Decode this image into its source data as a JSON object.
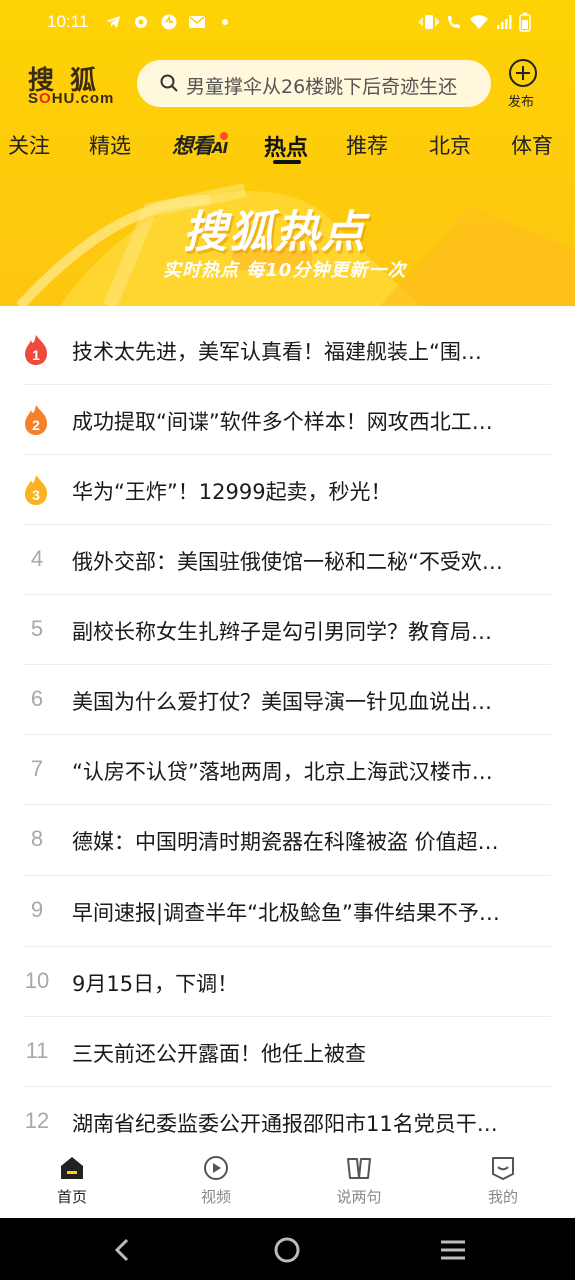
{
  "status_bar": {
    "time": "10:11",
    "left_icons": [
      "telegram-icon",
      "settings-icon",
      "app-icon",
      "mail-icon",
      "dot-icon"
    ],
    "right_icons": [
      "vibrate-icon",
      "wifi-call-icon",
      "wifi-icon",
      "signal-icon",
      "battery-icon"
    ]
  },
  "header": {
    "logo_cn": "搜狐",
    "logo_en_prefix": "S",
    "logo_en_o": "O",
    "logo_en_suffix": "HU.com",
    "search_placeholder": "男童撑伞从26楼跳下后奇迹生还",
    "publish_label": "发布"
  },
  "tabs": [
    {
      "label": "关注"
    },
    {
      "label": "精选"
    },
    {
      "label": "想看",
      "suffix": "AI"
    },
    {
      "label": "热点",
      "active": true
    },
    {
      "label": "推荐"
    },
    {
      "label": "北京"
    },
    {
      "label": "体育"
    }
  ],
  "banner": {
    "title": "搜狐热点",
    "subtitle": "实时热点 每10分钟更新一次"
  },
  "hot_list": [
    {
      "rank": "1",
      "title": "技术太先进，美军认真看！福建舰装上“围…",
      "hot": true,
      "color": "#f04a3b"
    },
    {
      "rank": "2",
      "title": "成功提取“间谍”软件多个样本！网攻西北工…",
      "hot": true,
      "color": "#f7812b"
    },
    {
      "rank": "3",
      "title": "华为“王炸”！12999起卖，秒光！",
      "hot": true,
      "color": "#fbb321"
    },
    {
      "rank": "4",
      "title": "俄外交部：美国驻俄使馆一秘和二秘“不受欢…"
    },
    {
      "rank": "5",
      "title": "副校长称女生扎辫子是勾引男同学？教育局…"
    },
    {
      "rank": "6",
      "title": "美国为什么爱打仗？美国导演一针见血说出…"
    },
    {
      "rank": "7",
      "title": "“认房不认贷”落地两周，北京上海武汉楼市…"
    },
    {
      "rank": "8",
      "title": "德媒：中国明清时期瓷器在科隆被盗 价值超…"
    },
    {
      "rank": "9",
      "title": "早间速报|调查半年“北极鲶鱼”事件结果不予…"
    },
    {
      "rank": "10",
      "title": "9月15日，下调！"
    },
    {
      "rank": "11",
      "title": "三天前还公开露面！他任上被查"
    },
    {
      "rank": "12",
      "title": "湖南省纪委监委公开通报邵阳市11名党员干…"
    }
  ],
  "bottom_nav": [
    {
      "label": "首页",
      "icon": "home-icon",
      "active": true
    },
    {
      "label": "视频",
      "icon": "play-icon"
    },
    {
      "label": "说两句",
      "icon": "book-icon"
    },
    {
      "label": "我的",
      "icon": "profile-icon"
    }
  ],
  "colors": {
    "brand_yellow": "#fed304",
    "rank1": "#f04a3b",
    "rank2": "#f7812b",
    "rank3": "#fbb321"
  }
}
